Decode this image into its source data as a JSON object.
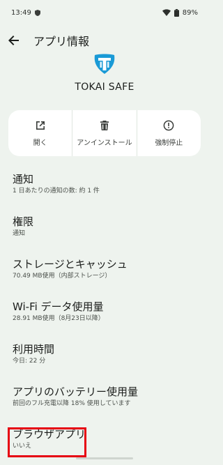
{
  "status_bar": {
    "time": "13:49",
    "battery": "89%"
  },
  "app_bar": {
    "title": "アプリ情報"
  },
  "app": {
    "name": "TOKAI SAFE",
    "logo_color": "#1a9ad6"
  },
  "actions": [
    {
      "label": "開く",
      "icon": "open-external-icon"
    },
    {
      "label": "アンインストール",
      "icon": "trash-icon"
    },
    {
      "label": "強制停止",
      "icon": "alert-circle-icon"
    }
  ],
  "settings": [
    {
      "title": "通知",
      "subtitle": "1 日あたりの通知の数: 約 1 件"
    },
    {
      "title": "権限",
      "subtitle": "通知"
    },
    {
      "title": "ストレージとキャッシュ",
      "subtitle": "70.49 MB使用（内部ストレージ）"
    },
    {
      "title": "Wi-Fi データ使用量",
      "subtitle": "28.91 MB使用（8月23日以降）"
    },
    {
      "title": "利用時間",
      "subtitle": "今日: 22 分"
    },
    {
      "title": "アプリのバッテリー使用量",
      "subtitle": "前回のフル充電以降 18% 使用しています"
    },
    {
      "title": "ブラウザアプリ",
      "subtitle": "いいえ"
    }
  ],
  "colors": {
    "background": "#eef3ee",
    "card": "#ffffff",
    "highlight": "#e60012"
  }
}
